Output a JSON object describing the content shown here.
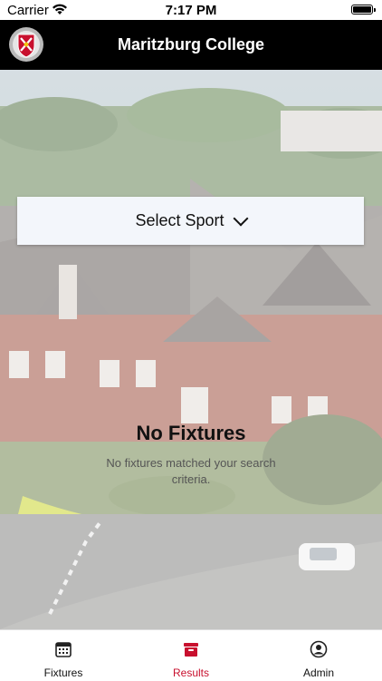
{
  "status_bar": {
    "carrier": "Carrier",
    "time": "7:17 PM"
  },
  "header": {
    "title": "Maritzburg College"
  },
  "select_sport": {
    "label": "Select Sport"
  },
  "empty_state": {
    "title": "No Fixtures",
    "message": "No fixtures matched your search criteria."
  },
  "tabs": [
    {
      "label": "Fixtures",
      "icon": "calendar-icon",
      "active": false
    },
    {
      "label": "Results",
      "icon": "archive-box-icon",
      "active": true
    },
    {
      "label": "Admin",
      "icon": "user-circle-icon",
      "active": false
    }
  ],
  "colors": {
    "accent": "#c8102e",
    "header_bg": "#000000"
  }
}
